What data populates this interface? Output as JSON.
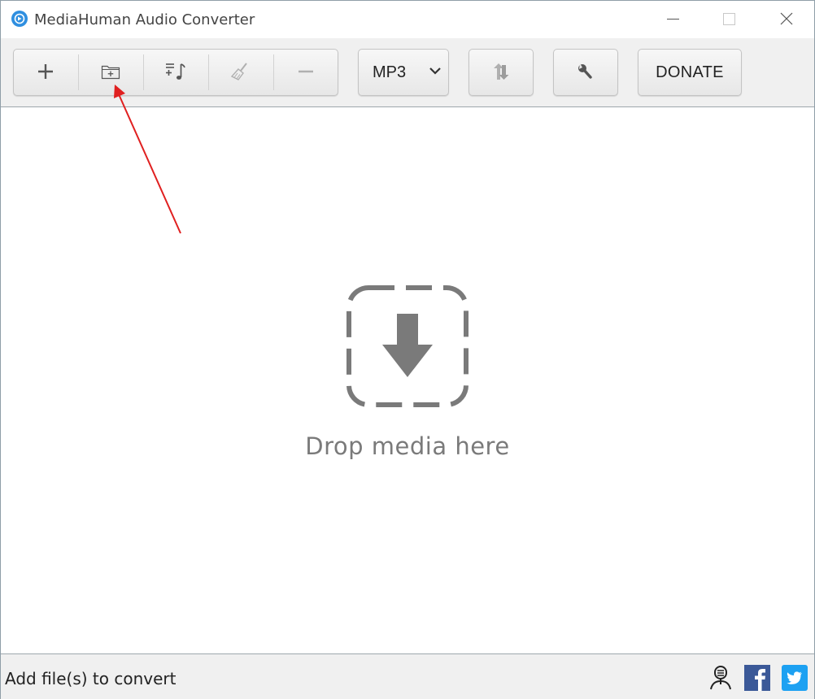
{
  "window": {
    "title": "MediaHuman Audio Converter",
    "app_icon": "mediahuman-logo-icon",
    "controls": [
      "minimize-icon",
      "maximize-icon",
      "close-icon"
    ]
  },
  "toolbar": {
    "buttons": [
      {
        "name": "add-files",
        "icon": "plus-icon"
      },
      {
        "name": "add-folder",
        "icon": "folder-plus-icon"
      },
      {
        "name": "add-to-itunes",
        "icon": "music-list-icon"
      },
      {
        "name": "clear-list",
        "icon": "broom-icon"
      },
      {
        "name": "remove",
        "icon": "minus-icon"
      }
    ],
    "format": {
      "selected": "MP3",
      "icon": "chevron-down-icon"
    },
    "convert_icon": "convert-arrows-icon",
    "settings_icon": "wrench-icon",
    "donate_label": "DONATE"
  },
  "content": {
    "drop_text": "Drop media here",
    "drop_icon": "download-arrow-icon"
  },
  "statusbar": {
    "status_text": "Add file(s) to convert",
    "social": [
      "podcast-icon",
      "facebook-icon",
      "twitter-icon"
    ]
  },
  "colors": {
    "toolbar_bg": "#f0f0f0",
    "icon_gray": "#7a7a7a",
    "annotation_red": "#e02020",
    "facebook_blue": "#3b5998",
    "twitter_blue": "#1da1f2",
    "app_icon_blue": "#2f8fe0"
  }
}
